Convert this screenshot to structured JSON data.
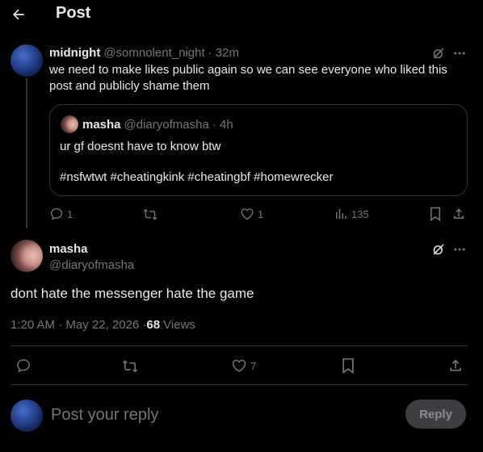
{
  "header": {
    "title": "Post",
    "back_icon": "arrow-left-icon"
  },
  "parent_post": {
    "display_name": "midnight",
    "handle": "@somnolent_night",
    "time": "· 32m",
    "text": "we need to make likes public again so we can see everyone who liked this post and publicly shame them",
    "quote": {
      "display_name": "masha",
      "handle": "@diaryofmasha",
      "time": "· 4h",
      "line1": "ur gf doesnt have to know btw",
      "line2": "#nsfwtwt #cheatingkink #cheatingbf #homewrecker"
    },
    "actions": {
      "replies": "1",
      "reposts": "",
      "likes": "1",
      "views": "135"
    }
  },
  "main_post": {
    "display_name": "masha",
    "handle": "@diaryofmasha",
    "text": "dont hate the messenger hate the game",
    "timestamp": "1:20 AM · May 22, 2026 · ",
    "views_count": "68",
    "views_label": "Views",
    "actions": {
      "likes": "7"
    }
  },
  "reply_box": {
    "placeholder": "Post your reply",
    "button_label": "Reply"
  },
  "colors": {
    "background": "#000000",
    "text": "#e7e9ea",
    "muted": "#71767b",
    "border": "#2f3336",
    "reply_button": "#3d3f42"
  }
}
